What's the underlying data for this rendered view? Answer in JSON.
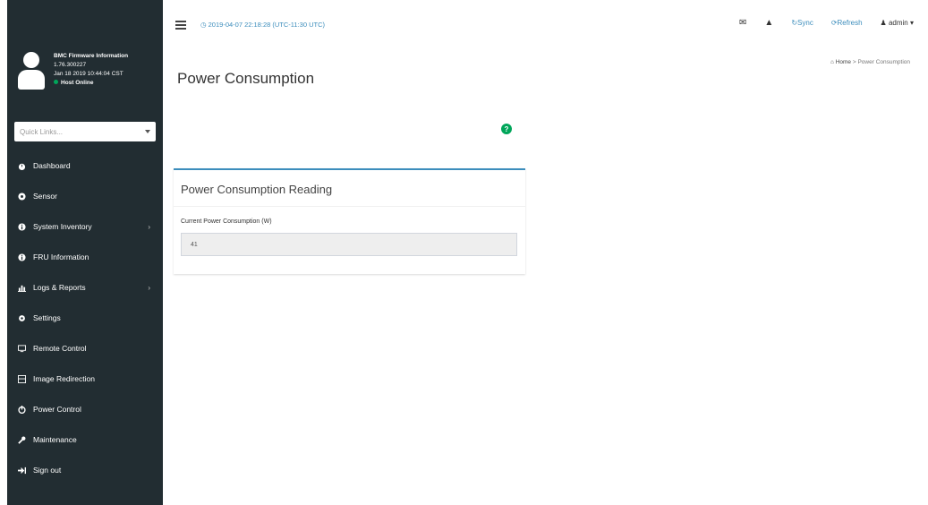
{
  "header": {
    "datetime": "2019-04-07 22:18:28 (UTC-11:30 UTC)",
    "sync_label": "Sync",
    "refresh_label": "Refresh",
    "user_label": "admin"
  },
  "sidebar": {
    "firmware_title": "BMC Firmware Information",
    "firmware_version": "1.76.300227",
    "firmware_date": "Jan 18 2019 10:44:04 CST",
    "status": "Host Online",
    "quicklinks_placeholder": "Quick Links...",
    "items": [
      {
        "label": "Dashboard",
        "icon": "dashboard-icon",
        "has_submenu": false
      },
      {
        "label": "Sensor",
        "icon": "sensor-icon",
        "has_submenu": false
      },
      {
        "label": "System Inventory",
        "icon": "info-icon",
        "has_submenu": true
      },
      {
        "label": "FRU Information",
        "icon": "info-icon",
        "has_submenu": false
      },
      {
        "label": "Logs & Reports",
        "icon": "chart-icon",
        "has_submenu": true
      },
      {
        "label": "Settings",
        "icon": "gear-icon",
        "has_submenu": false
      },
      {
        "label": "Remote Control",
        "icon": "monitor-icon",
        "has_submenu": false
      },
      {
        "label": "Image Redirection",
        "icon": "image-icon",
        "has_submenu": false
      },
      {
        "label": "Power Control",
        "icon": "power-icon",
        "has_submenu": false
      },
      {
        "label": "Maintenance",
        "icon": "wrench-icon",
        "has_submenu": false
      },
      {
        "label": "Sign out",
        "icon": "signout-icon",
        "has_submenu": false
      }
    ]
  },
  "main": {
    "page_title": "Power Consumption",
    "breadcrumb_home": "Home",
    "breadcrumb_current": "Power Consumption",
    "box_title": "Power Consumption Reading",
    "field_label": "Current Power Consumption (W)",
    "field_value": "41"
  },
  "colors": {
    "sidebar_bg": "#222d32",
    "accent": "#3c8dbc",
    "online": "#00a65a"
  }
}
